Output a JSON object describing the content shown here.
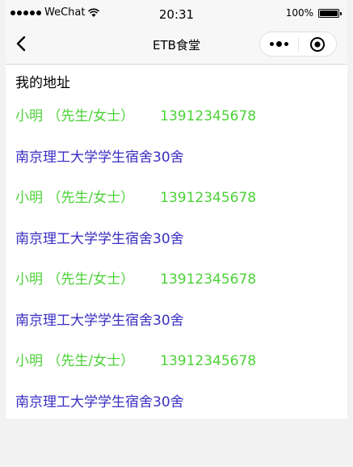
{
  "status_bar": {
    "carrier": "WeChat",
    "time": "20:31",
    "battery": "100%"
  },
  "nav": {
    "title": "ETB食堂"
  },
  "page": {
    "heading": "我的地址"
  },
  "addresses": [
    {
      "name": "小明 （先生/女士）",
      "phone": "13912345678",
      "address": "南京理工大学学生宿舍30舍"
    },
    {
      "name": "小明 （先生/女士）",
      "phone": "13912345678",
      "address": "南京理工大学学生宿舍30舍"
    },
    {
      "name": "小明 （先生/女士）",
      "phone": "13912345678",
      "address": "南京理工大学学生宿舍30舍"
    },
    {
      "name": "小明 （先生/女士）",
      "phone": "13912345678",
      "address": "南京理工大学学生宿舍30舍"
    }
  ],
  "colors": {
    "contact": "#4cd137",
    "address": "#3a2ec2"
  }
}
